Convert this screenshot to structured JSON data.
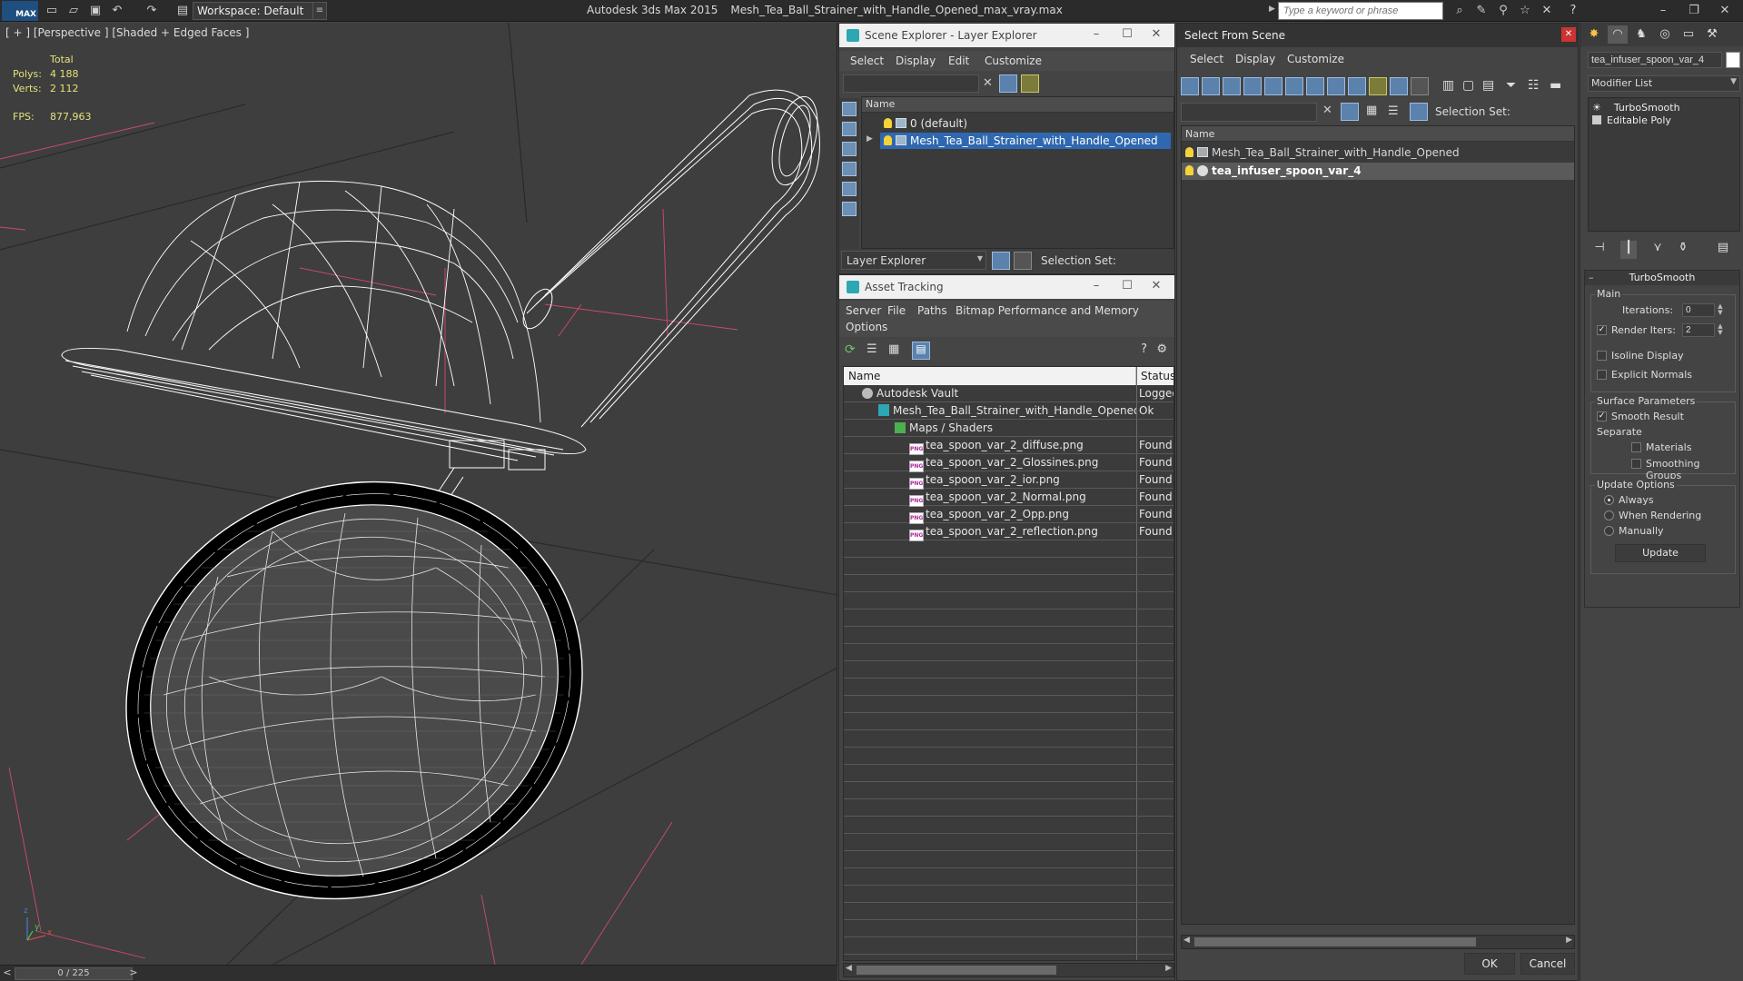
{
  "titlebar": {
    "logo": "MAX",
    "workspace_value": "Workspace: Default",
    "app_name": "Autodesk 3ds Max  2015",
    "file_name": "Mesh_Tea_Ball_Strainer_with_Handle_Opened_max_vray.max",
    "search_placeholder": "Type a keyword or phrase"
  },
  "viewport": {
    "label": "[ + ] [Perspective ] [Shaded + Edged Faces ]",
    "stats": {
      "total_label": "Total",
      "polys_label": "Polys:",
      "polys_value": "4 188",
      "verts_label": "Verts:",
      "verts_value": "2 112",
      "fps_label": "FPS:",
      "fps_value": "877,963"
    },
    "axis_labels": {
      "x": "x",
      "y": "y",
      "z": "z"
    }
  },
  "timeslider": {
    "value": "0 / 225"
  },
  "scene_explorer": {
    "title": "Scene Explorer - Layer Explorer",
    "menu": [
      "Select",
      "Display",
      "Edit",
      "Customize"
    ],
    "column_name": "Name",
    "rows": [
      {
        "label": "0 (default)"
      },
      {
        "label": "Mesh_Tea_Ball_Strainer_with_Handle_Opened"
      }
    ],
    "footer_combo": "Layer Explorer",
    "selection_set_label": "Selection Set:"
  },
  "asset_tracking": {
    "title": "Asset Tracking",
    "menu": [
      "Server",
      "File",
      "Paths",
      "Bitmap Performance and Memory",
      "Options"
    ],
    "columns": [
      "Name",
      "Status"
    ],
    "rows": [
      {
        "name": "Autodesk Vault",
        "status": "Logged"
      },
      {
        "name": "Mesh_Tea_Ball_Strainer_with_Handle_Opened_...",
        "status": "Ok"
      },
      {
        "name": "Maps / Shaders",
        "status": ""
      },
      {
        "name": "tea_spoon_var_2_diffuse.png",
        "status": "Found"
      },
      {
        "name": "tea_spoon_var_2_Glossines.png",
        "status": "Found"
      },
      {
        "name": "tea_spoon_var_2_ior.png",
        "status": "Found"
      },
      {
        "name": "tea_spoon_var_2_Normal.png",
        "status": "Found"
      },
      {
        "name": "tea_spoon_var_2_Opp.png",
        "status": "Found"
      },
      {
        "name": "tea_spoon_var_2_reflection.png",
        "status": "Found"
      }
    ],
    "png_badge": "PNG"
  },
  "select_from_scene": {
    "title": "Select From Scene",
    "menu": [
      "Select",
      "Display",
      "Customize"
    ],
    "selection_set_label": "Selection Set:",
    "column_name": "Name",
    "rows": [
      {
        "label": "Mesh_Tea_Ball_Strainer_with_Handle_Opened"
      },
      {
        "label": "tea_infuser_spoon_var_4"
      }
    ],
    "ok_label": "OK",
    "cancel_label": "Cancel"
  },
  "command_panel": {
    "object_name": "tea_infuser_spoon_var_4",
    "modifier_list": "Modifier List",
    "stack": [
      "TurboSmooth",
      "Editable Poly"
    ],
    "rollout_title": "TurboSmooth",
    "main_group": "Main",
    "iterations_label": "Iterations:",
    "iterations_value": "0",
    "render_iters_label": "Render Iters:",
    "render_iters_value": "2",
    "render_iters_checked": true,
    "isoline_label": "Isoline Display",
    "explicit_normals_label": "Explicit Normals",
    "surface_group": "Surface Parameters",
    "smooth_result_label": "Smooth Result",
    "separate_label": "Separate",
    "materials_label": "Materials",
    "smoothing_groups_label": "Smoothing Groups",
    "update_group": "Update Options",
    "always_label": "Always",
    "when_rendering_label": "When Rendering",
    "manually_label": "Manually",
    "update_button": "Update"
  },
  "colors": {
    "viewport_bg": "#3e3e3e",
    "stats_yellow": "#e4e27a",
    "selection_blue": "#2f68b0",
    "wire_white": "#ffffff",
    "grid_red": "#d04a6a",
    "close_red": "#cc3333"
  },
  "icons": {
    "qa": [
      "new-file-icon",
      "open-icon",
      "save-icon",
      "undo-icon",
      "redo-icon",
      "project-icon"
    ],
    "titlebar_right": [
      "binoculars-icon",
      "tools-icon",
      "connect-icon",
      "star-icon",
      "exchange-icon",
      "help-icon"
    ]
  }
}
